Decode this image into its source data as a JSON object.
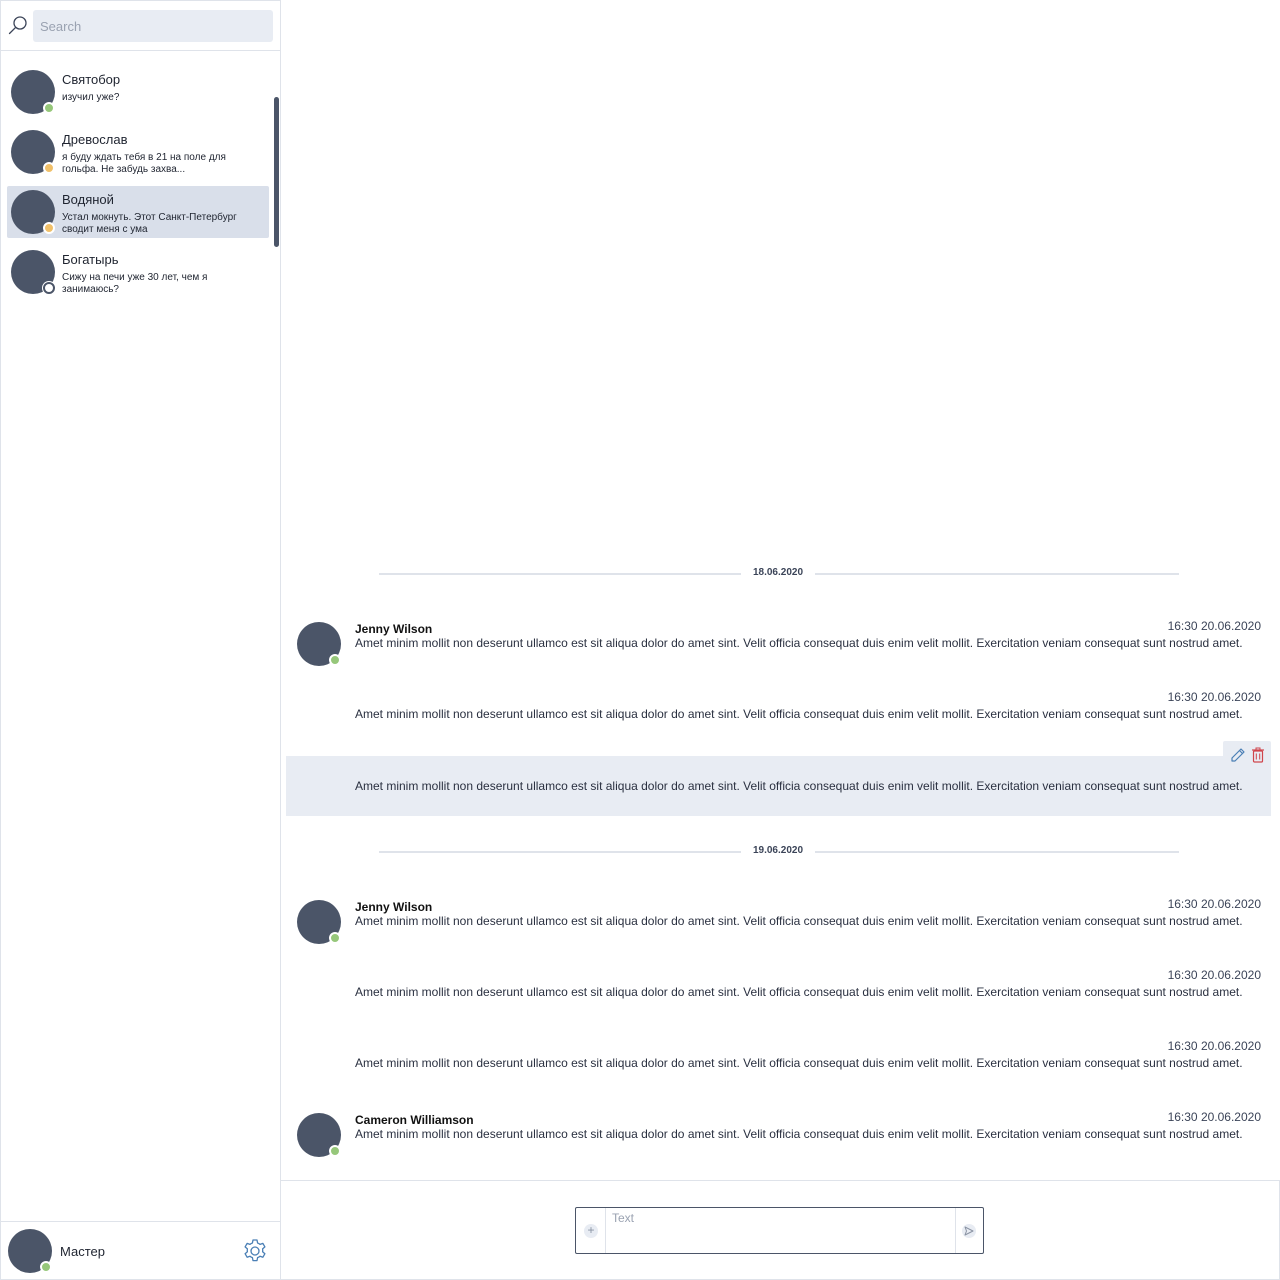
{
  "search": {
    "placeholder": "Search"
  },
  "contacts": [
    {
      "name": "Святобор",
      "preview": "изучил уже?",
      "status": "online"
    },
    {
      "name": "Древослав",
      "preview": "я буду ждать тебя в 21 на поле для гольфа. Не забудь захва...",
      "status": "away"
    },
    {
      "name": "Водяной",
      "preview": "Устал мокнуть. Этот Санкт-Петербург сводит меня с ума",
      "status": "away",
      "active": true
    },
    {
      "name": "Богатырь",
      "preview": "Сижу на печи уже 30 лет, чем я занимаюсь?",
      "status": "offline"
    }
  ],
  "current_user": {
    "name": "Мастер",
    "status": "online"
  },
  "chat": {
    "dates": [
      "18.06.2020",
      "19.06.2020"
    ],
    "messages": [
      {
        "author": "Jenny Wilson",
        "time": "16:30 20.06.2020",
        "text": "Amet minim mollit non deserunt ullamco est sit aliqua dolor do amet sint. Velit officia consequat duis enim velit mollit. Exercitation veniam consequat sunt nostrud amet."
      },
      {
        "author": "",
        "time": "16:30 20.06.2020",
        "text": "Amet minim mollit non deserunt ullamco est sit aliqua dolor do amet sint. Velit officia consequat duis enim velit mollit. Exercitation veniam consequat sunt nostrud amet."
      },
      {
        "author": "",
        "time": "",
        "text": "Amet minim mollit non deserunt ullamco est sit aliqua dolor do amet sint. Velit officia consequat duis enim velit mollit. Exercitation veniam consequat sunt nostrud amet."
      },
      {
        "author": "Jenny Wilson",
        "time": "16:30 20.06.2020",
        "text": "Amet minim mollit non deserunt ullamco est sit aliqua dolor do amet sint. Velit officia consequat duis enim velit mollit. Exercitation veniam consequat sunt nostrud amet."
      },
      {
        "author": "",
        "time": "16:30 20.06.2020",
        "text": "Amet minim mollit non deserunt ullamco est sit aliqua dolor do amet sint. Velit officia consequat duis enim velit mollit. Exercitation veniam consequat sunt nostrud amet."
      },
      {
        "author": "",
        "time": "16:30 20.06.2020",
        "text": "Amet minim mollit non deserunt ullamco est sit aliqua dolor do amet sint. Velit officia consequat duis enim velit mollit. Exercitation veniam consequat sunt nostrud amet."
      },
      {
        "author": "Cameron Williamson",
        "time": "16:30 20.06.2020",
        "text": "Amet minim mollit non deserunt ullamco est sit aliqua dolor do amet sint. Velit officia consequat duis enim velit mollit. Exercitation veniam consequat sunt nostrud amet."
      }
    ]
  },
  "composer": {
    "placeholder": "Text"
  },
  "icons": {
    "search": "search-icon",
    "settings": "gear-icon",
    "edit": "pencil-icon",
    "delete": "trash-icon",
    "attach": "plus-icon",
    "send": "send-icon"
  },
  "colors": {
    "avatar": "#4b5568",
    "online": "#96c77a",
    "away": "#f0c06a",
    "active_row": "#d9dfea",
    "accent": "#4a7fb5",
    "delete": "#d0454c"
  }
}
